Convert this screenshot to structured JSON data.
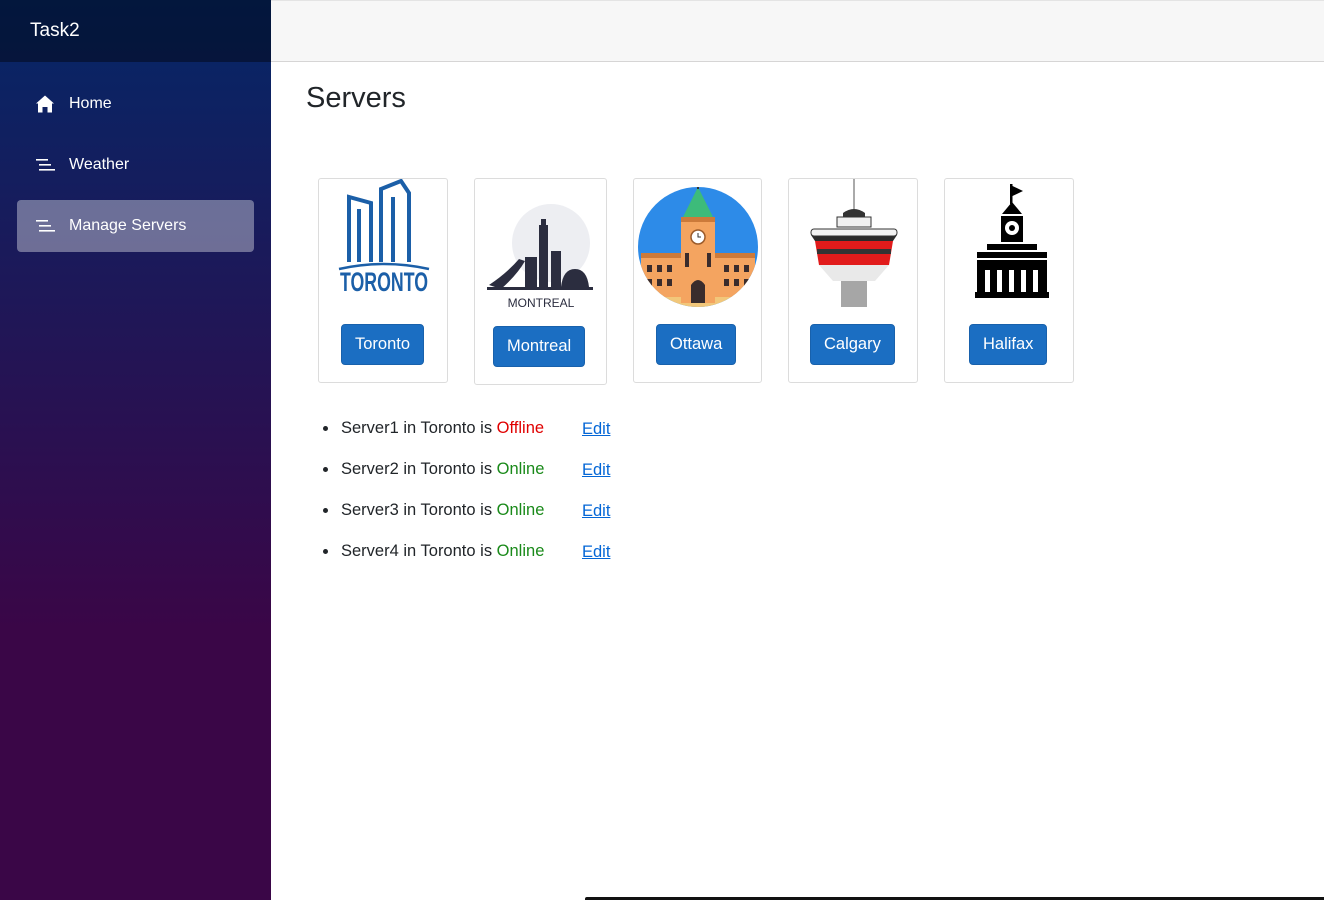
{
  "app": {
    "title": "Task2"
  },
  "nav": {
    "items": [
      {
        "label": "Home",
        "icon": "home-icon"
      },
      {
        "label": "Weather",
        "icon": "list-icon"
      },
      {
        "label": "Manage Servers",
        "icon": "list-icon",
        "active": true
      }
    ]
  },
  "page": {
    "title": "Servers"
  },
  "cities": [
    {
      "name": "Toronto",
      "logo_text": "TORONTO",
      "icon": "toronto-city-hall-icon"
    },
    {
      "name": "Montreal",
      "logo_text": "MONTREAL",
      "icon": "montreal-olympic-tower-icon"
    },
    {
      "name": "Ottawa",
      "icon": "ottawa-parliament-icon"
    },
    {
      "name": "Calgary",
      "icon": "calgary-tower-icon"
    },
    {
      "name": "Halifax",
      "icon": "halifax-town-clock-icon"
    }
  ],
  "servers": [
    {
      "name": "Server1",
      "city": "Toronto",
      "status": "Offline",
      "edit_label": "Edit"
    },
    {
      "name": "Server2",
      "city": "Toronto",
      "status": "Online",
      "edit_label": "Edit"
    },
    {
      "name": "Server3",
      "city": "Toronto",
      "status": "Online",
      "edit_label": "Edit"
    },
    {
      "name": "Server4",
      "city": "Toronto",
      "status": "Online",
      "edit_label": "Edit"
    }
  ],
  "text": {
    "in": "in",
    "is": "is"
  },
  "colors": {
    "primary_button": "#1b6ec2",
    "offline": "#e00000",
    "online": "#1a8a1a",
    "link": "#0366d6"
  }
}
